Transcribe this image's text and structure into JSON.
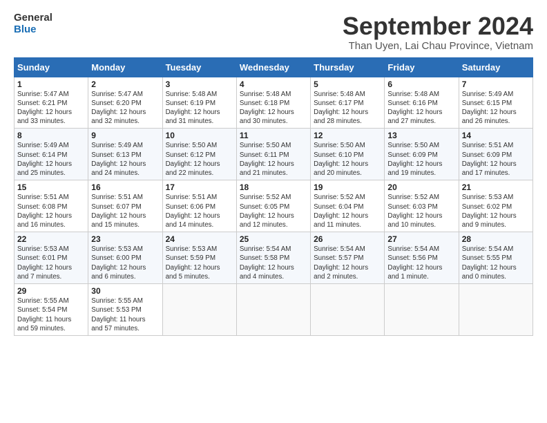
{
  "logo": {
    "line1": "General",
    "line2": "Blue"
  },
  "title": "September 2024",
  "subtitle": "Than Uyen, Lai Chau Province, Vietnam",
  "headers": [
    "Sunday",
    "Monday",
    "Tuesday",
    "Wednesday",
    "Thursday",
    "Friday",
    "Saturday"
  ],
  "weeks": [
    [
      {
        "day": "1",
        "info": "Sunrise: 5:47 AM\nSunset: 6:21 PM\nDaylight: 12 hours\nand 33 minutes."
      },
      {
        "day": "2",
        "info": "Sunrise: 5:47 AM\nSunset: 6:20 PM\nDaylight: 12 hours\nand 32 minutes."
      },
      {
        "day": "3",
        "info": "Sunrise: 5:48 AM\nSunset: 6:19 PM\nDaylight: 12 hours\nand 31 minutes."
      },
      {
        "day": "4",
        "info": "Sunrise: 5:48 AM\nSunset: 6:18 PM\nDaylight: 12 hours\nand 30 minutes."
      },
      {
        "day": "5",
        "info": "Sunrise: 5:48 AM\nSunset: 6:17 PM\nDaylight: 12 hours\nand 28 minutes."
      },
      {
        "day": "6",
        "info": "Sunrise: 5:48 AM\nSunset: 6:16 PM\nDaylight: 12 hours\nand 27 minutes."
      },
      {
        "day": "7",
        "info": "Sunrise: 5:49 AM\nSunset: 6:15 PM\nDaylight: 12 hours\nand 26 minutes."
      }
    ],
    [
      {
        "day": "8",
        "info": "Sunrise: 5:49 AM\nSunset: 6:14 PM\nDaylight: 12 hours\nand 25 minutes."
      },
      {
        "day": "9",
        "info": "Sunrise: 5:49 AM\nSunset: 6:13 PM\nDaylight: 12 hours\nand 24 minutes."
      },
      {
        "day": "10",
        "info": "Sunrise: 5:50 AM\nSunset: 6:12 PM\nDaylight: 12 hours\nand 22 minutes."
      },
      {
        "day": "11",
        "info": "Sunrise: 5:50 AM\nSunset: 6:11 PM\nDaylight: 12 hours\nand 21 minutes."
      },
      {
        "day": "12",
        "info": "Sunrise: 5:50 AM\nSunset: 6:10 PM\nDaylight: 12 hours\nand 20 minutes."
      },
      {
        "day": "13",
        "info": "Sunrise: 5:50 AM\nSunset: 6:09 PM\nDaylight: 12 hours\nand 19 minutes."
      },
      {
        "day": "14",
        "info": "Sunrise: 5:51 AM\nSunset: 6:09 PM\nDaylight: 12 hours\nand 17 minutes."
      }
    ],
    [
      {
        "day": "15",
        "info": "Sunrise: 5:51 AM\nSunset: 6:08 PM\nDaylight: 12 hours\nand 16 minutes."
      },
      {
        "day": "16",
        "info": "Sunrise: 5:51 AM\nSunset: 6:07 PM\nDaylight: 12 hours\nand 15 minutes."
      },
      {
        "day": "17",
        "info": "Sunrise: 5:51 AM\nSunset: 6:06 PM\nDaylight: 12 hours\nand 14 minutes."
      },
      {
        "day": "18",
        "info": "Sunrise: 5:52 AM\nSunset: 6:05 PM\nDaylight: 12 hours\nand 12 minutes."
      },
      {
        "day": "19",
        "info": "Sunrise: 5:52 AM\nSunset: 6:04 PM\nDaylight: 12 hours\nand 11 minutes."
      },
      {
        "day": "20",
        "info": "Sunrise: 5:52 AM\nSunset: 6:03 PM\nDaylight: 12 hours\nand 10 minutes."
      },
      {
        "day": "21",
        "info": "Sunrise: 5:53 AM\nSunset: 6:02 PM\nDaylight: 12 hours\nand 9 minutes."
      }
    ],
    [
      {
        "day": "22",
        "info": "Sunrise: 5:53 AM\nSunset: 6:01 PM\nDaylight: 12 hours\nand 7 minutes."
      },
      {
        "day": "23",
        "info": "Sunrise: 5:53 AM\nSunset: 6:00 PM\nDaylight: 12 hours\nand 6 minutes."
      },
      {
        "day": "24",
        "info": "Sunrise: 5:53 AM\nSunset: 5:59 PM\nDaylight: 12 hours\nand 5 minutes."
      },
      {
        "day": "25",
        "info": "Sunrise: 5:54 AM\nSunset: 5:58 PM\nDaylight: 12 hours\nand 4 minutes."
      },
      {
        "day": "26",
        "info": "Sunrise: 5:54 AM\nSunset: 5:57 PM\nDaylight: 12 hours\nand 2 minutes."
      },
      {
        "day": "27",
        "info": "Sunrise: 5:54 AM\nSunset: 5:56 PM\nDaylight: 12 hours\nand 1 minute."
      },
      {
        "day": "28",
        "info": "Sunrise: 5:54 AM\nSunset: 5:55 PM\nDaylight: 12 hours\nand 0 minutes."
      }
    ],
    [
      {
        "day": "29",
        "info": "Sunrise: 5:55 AM\nSunset: 5:54 PM\nDaylight: 11 hours\nand 59 minutes."
      },
      {
        "day": "30",
        "info": "Sunrise: 5:55 AM\nSunset: 5:53 PM\nDaylight: 11 hours\nand 57 minutes."
      },
      {
        "day": "",
        "info": ""
      },
      {
        "day": "",
        "info": ""
      },
      {
        "day": "",
        "info": ""
      },
      {
        "day": "",
        "info": ""
      },
      {
        "day": "",
        "info": ""
      }
    ]
  ]
}
